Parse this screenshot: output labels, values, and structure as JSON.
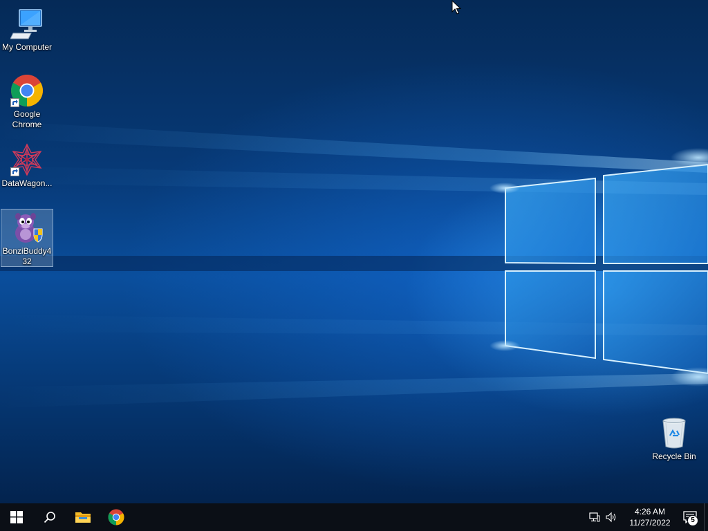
{
  "desktop": {
    "icons": [
      {
        "label": "My Computer",
        "icon": "computer-icon",
        "shortcut": false,
        "selected": false
      },
      {
        "label": "Google Chrome",
        "icon": "chrome-icon",
        "shortcut": true,
        "selected": false
      },
      {
        "label": "DataWagon...",
        "icon": "datawagon-icon",
        "shortcut": true,
        "selected": false
      },
      {
        "label": "BonziBuddy432",
        "icon": "bonzibuddy-icon",
        "shortcut": false,
        "selected": true
      },
      {
        "label": "Recycle Bin",
        "icon": "recycle-bin-icon",
        "shortcut": false,
        "selected": false
      }
    ]
  },
  "taskbar": {
    "start": {
      "icon": "windows-start-icon"
    },
    "search": {
      "icon": "search-icon"
    },
    "pinned": [
      {
        "name": "File Explorer",
        "icon": "file-explorer-icon"
      },
      {
        "name": "Google Chrome",
        "icon": "chrome-icon"
      }
    ],
    "tray": {
      "network_icon": "network-icon",
      "volume_icon": "volume-icon",
      "time": "4:26 AM",
      "date": "11/27/2022",
      "notifications_count": "5"
    }
  },
  "colors": {
    "taskbar_bg": "#0b0f16",
    "selection_bg": "#8caac8",
    "accent": "#76b9ed"
  }
}
